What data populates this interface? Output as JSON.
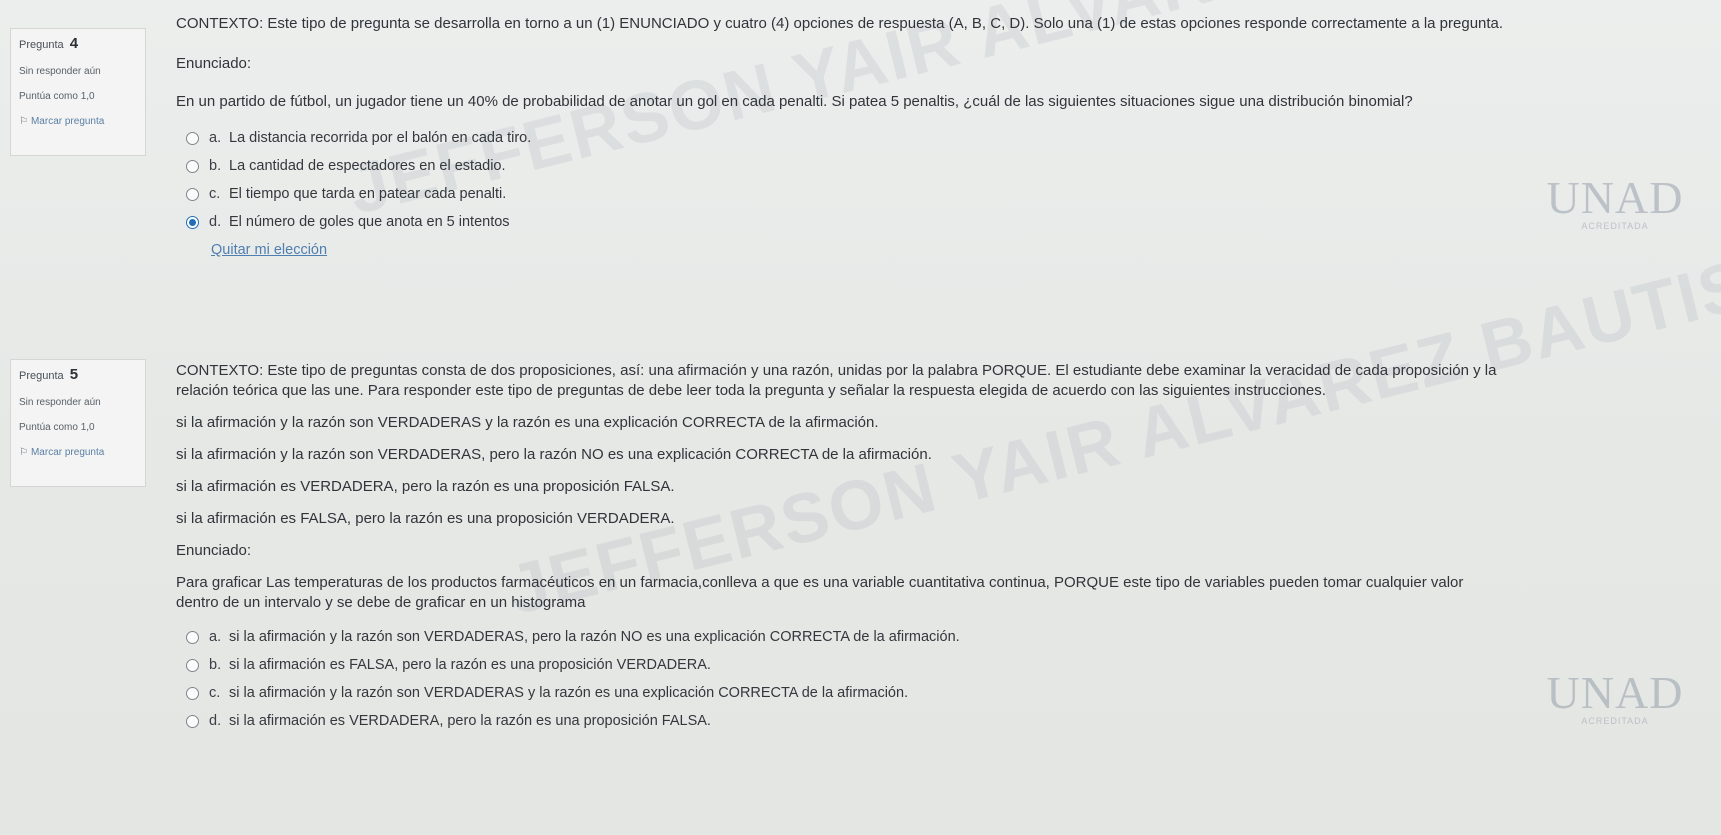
{
  "q4": {
    "info": {
      "title": "Pregunta",
      "number": "4",
      "status": "Sin responder aún",
      "score": "Puntúa como 1,0",
      "flag_label": "Marcar pregunta"
    },
    "context": "CONTEXTO: Este tipo de pregunta se desarrolla en torno a un (1) ENUNCIADO y cuatro (4) opciones de respuesta (A, B, C, D). Solo una (1) de estas opciones responde correctamente a la pregunta.",
    "enunciado_label": "Enunciado:",
    "question": "En un partido de fútbol, un jugador tiene un 40% de probabilidad de anotar un gol en cada penalti. Si patea 5 penaltis, ¿cuál de las siguientes situaciones sigue una distribución binomial?",
    "options": [
      {
        "letter": "a.",
        "text": "La distancia recorrida por el balón en cada tiro.",
        "checked": false
      },
      {
        "letter": "b.",
        "text": "La cantidad de espectadores en el estadio.",
        "checked": false
      },
      {
        "letter": "c.",
        "text": "El tiempo que tarda en patear cada penalti.",
        "checked": false
      },
      {
        "letter": "d.",
        "text": "El número de goles que anota en 5 intentos",
        "checked": true
      }
    ],
    "remove_choice": "Quitar mi elección"
  },
  "q5": {
    "info": {
      "title": "Pregunta",
      "number": "5",
      "status": "Sin responder aún",
      "score": "Puntúa como 1,0",
      "flag_label": "Marcar pregunta"
    },
    "context_1": "CONTEXTO: Este tipo de preguntas consta de dos proposiciones, así: una afirmación y una razón, unidas por la palabra PORQUE. El estudiante debe examinar la veracidad de cada proposición y la",
    "context_2": "relación teórica que las une. Para responder este tipo de preguntas de debe leer toda la pregunta y señalar la respuesta elegida de acuerdo con las siguientes instrucciones.",
    "instructions": [
      "si la afirmación y la razón son VERDADERAS y la razón es una explicación CORRECTA de la afirmación.",
      "si la afirmación y la razón son VERDADERAS, pero la razón NO es una explicación CORRECTA de la afirmación.",
      "si la afirmación es VERDADERA, pero la razón es una proposición FALSA.",
      "si la afirmación es FALSA, pero la razón es una proposición VERDADERA."
    ],
    "enunciado_label": "Enunciado:",
    "question_1": "Para graficar Las temperaturas de los productos farmacéuticos en un farmacia,conlleva a que es una variable cuantitativa continua, PORQUE este tipo de variables pueden tomar cualquier valor",
    "question_2": "dentro de un intervalo y se debe de graficar en un histograma",
    "options": [
      {
        "letter": "a.",
        "text": "si la afirmación y la razón son VERDADERAS, pero la razón NO es una explicación CORRECTA de la afirmación.",
        "checked": false
      },
      {
        "letter": "b.",
        "text": "si la afirmación es FALSA, pero la razón es una proposición VERDADERA.",
        "checked": false
      },
      {
        "letter": "c.",
        "text": "si la afirmación y la razón son VERDADERAS y la razón es una explicación CORRECTA de la afirmación.",
        "checked": false
      },
      {
        "letter": "d.",
        "text": "si la afirmación es VERDADERA, pero la razón es una proposición FALSA.",
        "checked": false
      }
    ]
  },
  "watermark": {
    "text_1": "JEFFERSON YAIR ALVAREZ BAUTISTA",
    "text_2": "JEFFERSON YAIR ALVAREZ BAUTISTA"
  },
  "logo": {
    "mark": "UNAD",
    "sub": "ACREDITADA"
  }
}
